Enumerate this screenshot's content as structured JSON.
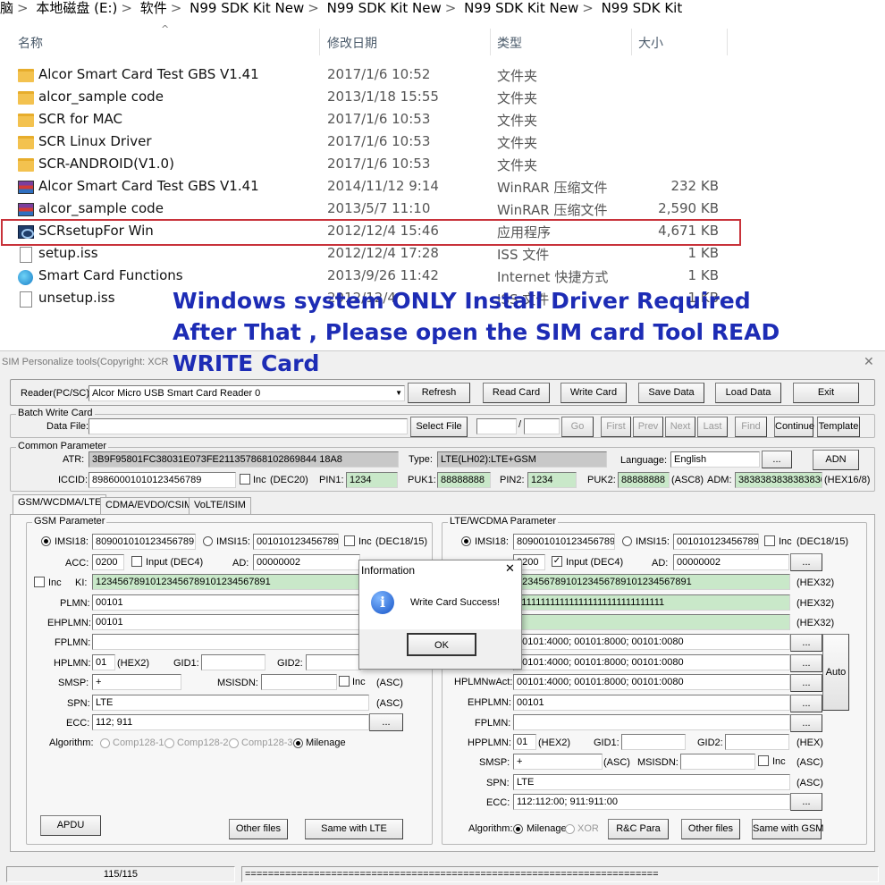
{
  "explorer": {
    "breadcrumb": [
      "脑",
      "本地磁盘 (E:)",
      "软件",
      "N99 SDK Kit New",
      "N99 SDK Kit New",
      "N99 SDK Kit New",
      "N99 SDK Kit"
    ],
    "columns": {
      "name": "名称",
      "date": "修改日期",
      "type": "类型",
      "size": "大小"
    },
    "files": [
      {
        "name": "Alcor Smart Card Test GBS V1.41",
        "date": "2017/1/6 10:52",
        "type": "文件夹",
        "size": "",
        "icon": "folder-icon"
      },
      {
        "name": "alcor_sample code",
        "date": "2013/1/18 15:55",
        "type": "文件夹",
        "size": "",
        "icon": "folder-icon"
      },
      {
        "name": "SCR for MAC",
        "date": "2017/1/6 10:53",
        "type": "文件夹",
        "size": "",
        "icon": "folder-icon"
      },
      {
        "name": "SCR Linux Driver",
        "date": "2017/1/6 10:53",
        "type": "文件夹",
        "size": "",
        "icon": "folder-icon"
      },
      {
        "name": "SCR-ANDROID(V1.0)",
        "date": "2017/1/6 10:53",
        "type": "文件夹",
        "size": "",
        "icon": "folder-icon"
      },
      {
        "name": "Alcor Smart Card Test GBS V1.41",
        "date": "2014/11/12 9:14",
        "type": "WinRAR 压缩文件",
        "size": "232 KB",
        "icon": "rar-icon"
      },
      {
        "name": "alcor_sample code",
        "date": "2013/5/7 11:10",
        "type": "WinRAR 压缩文件",
        "size": "2,590 KB",
        "icon": "rar-icon"
      },
      {
        "name": "SCRsetupFor Win",
        "date": "2012/12/4 15:46",
        "type": "应用程序",
        "size": "4,671 KB",
        "icon": "exe-icon"
      },
      {
        "name": "setup.iss",
        "date": "2012/12/4 17:28",
        "type": "ISS 文件",
        "size": "1 KB",
        "icon": "document-icon"
      },
      {
        "name": "Smart Card Functions",
        "date": "2013/9/26 11:42",
        "type": "Internet 快捷方式",
        "size": "1 KB",
        "icon": "web-shortcut-icon"
      },
      {
        "name": "unsetup.iss",
        "date": "2012/12/4",
        "type": "ISS 文件",
        "size": "1 KB",
        "icon": "document-icon"
      }
    ]
  },
  "overlay": {
    "line1": "Windows system ONLY  Install Driver Required",
    "line2": "After That , Please open the SIM card Tool READ",
    "line3": "WRITE Card"
  },
  "tool": {
    "title": "SIM Personalize tools(Copyright: XCR",
    "reader_label": "Reader(PC/SC):",
    "reader_value": "Alcor Micro USB Smart Card Reader 0",
    "buttons": {
      "refresh": "Refresh",
      "read": "Read Card",
      "write": "Write Card",
      "save": "Save Data",
      "load": "Load Data",
      "exit": "Exit"
    },
    "batch": {
      "title": "Batch Write Card",
      "datafile": "Data File:",
      "select": "Select File",
      "sep": "/",
      "go": "Go",
      "first": "First",
      "prev": "Prev",
      "next": "Next",
      "last": "Last",
      "find": "Find",
      "continue": "Continue",
      "template": "Template"
    },
    "common": {
      "title": "Common Parameter",
      "atr_label": "ATR:",
      "atr": "3B9F95801FC38031E073FE211357868102869844 18A8",
      "type_label": "Type:",
      "type": "LTE(LH02):LTE+GSM",
      "lang_label": "Language:",
      "lang": "English",
      "dots": "...",
      "adn": "ADN",
      "iccid_label": "ICCID:",
      "iccid": "89860001010123456789",
      "inc": "Inc",
      "dec20": "(DEC20)",
      "pin1_label": "PIN1:",
      "pin1": "1234",
      "puk1_label": "PUK1:",
      "puk1": "88888888",
      "pin2_label": "PIN2:",
      "pin2": "1234",
      "puk2_label": "PUK2:",
      "puk2": "88888888",
      "asc8": "(ASC8)",
      "adm_label": "ADM:",
      "adm": "3838383838383830",
      "hex168": "(HEX16/8)"
    },
    "tabs": [
      "GSM/WCDMA/LTE",
      "CDMA/EVDO/CSIM",
      "VoLTE/ISIM"
    ],
    "gsm": {
      "title": "GSM Parameter",
      "imsi18_label": "IMSI18:",
      "imsi18": "809001010123456789",
      "imsi15_label": "IMSI15:",
      "imsi15": "001010123456789",
      "inc": "Inc",
      "dec1815": "(DEC18/15)",
      "acc_label": "ACC:",
      "acc": "0200",
      "input_dec4": "Input (DEC4)",
      "ad_label": "AD:",
      "ad": "00000002",
      "ki_inc": "Inc",
      "ki_label": "KI:",
      "ki": "12345678910123456789101234567891",
      "plmn_label": "PLMN:",
      "plmn": "00101",
      "ehplmn_label": "EHPLMN:",
      "ehplmn": "00101",
      "fplmn_label": "FPLMN:",
      "hplmn_label": "HPLMN:",
      "hplmn": "01",
      "hex2": "(HEX2)",
      "gid1_label": "GID1:",
      "gid2_label": "GID2:",
      "smsp_label": "SMSP:",
      "smsp": "+",
      "msisdn_label": "MSISDN:",
      "asc": "(ASC)",
      "spn_label": "SPN:",
      "spn": "LTE",
      "ecc_label": "ECC:",
      "ecc": "112; 911",
      "dots": "...",
      "algo_label": "Algorithm:",
      "algos": [
        "Comp128-1",
        "Comp128-2",
        "Comp128-3",
        "Milenage"
      ],
      "apdu": "APDU",
      "other": "Other files",
      "same": "Same with LTE"
    },
    "lte": {
      "title": "LTE/WCDMA Parameter",
      "imsi18_label": "IMSI18:",
      "imsi18": "809001010123456789",
      "imsi15_label": "IMSI15:",
      "imsi15": "001010123456789",
      "inc": "Inc",
      "dec1815": "(DEC18/15)",
      "acc_label": "ACC:",
      "acc": "0200",
      "input_dec4": "Input (DEC4)",
      "ad_label": "AD:",
      "ad": "00000002",
      "ki": "12345678910123456789101234567891",
      "opc": "1111111111111111111111111111111",
      "hex32": "(HEX32)",
      "row4": "00101:4000; 00101:8000; 00101:0080",
      "row5": "00101:4000; 00101:8000; 00101:0080",
      "hplmnwact_label": "HPLMNwAct:",
      "row6": "00101:4000; 00101:8000; 00101:0080",
      "auto": "Auto",
      "ehplmn_label": "EHPLMN:",
      "ehplmn": "00101",
      "fplmn_label": "FPLMN:",
      "hpplmn_label": "HPPLMN:",
      "hpplmn": "01",
      "hex2": "(HEX2)",
      "gid1_label": "GID1:",
      "gid2_label": "GID2:",
      "hex": "(HEX)",
      "smsp_label": "SMSP:",
      "smsp": "+",
      "asc": "(ASC)",
      "msisdn_label": "MSISDN:",
      "spn_label": "SPN:",
      "spn": "LTE",
      "ecc_label": "ECC:",
      "ecc": "112:112:00; 911:911:00",
      "dots": "...",
      "algo_label": "Algorithm:",
      "milenage": "Milenage",
      "xor": "XOR",
      "rc": "R&C Para",
      "other": "Other files",
      "same": "Same with GSM"
    },
    "dialog": {
      "title": "Information",
      "close": "✕",
      "message": "Write Card Success!",
      "ok": "OK"
    },
    "status": {
      "count": "115/115",
      "progress": "========================================================================"
    }
  }
}
